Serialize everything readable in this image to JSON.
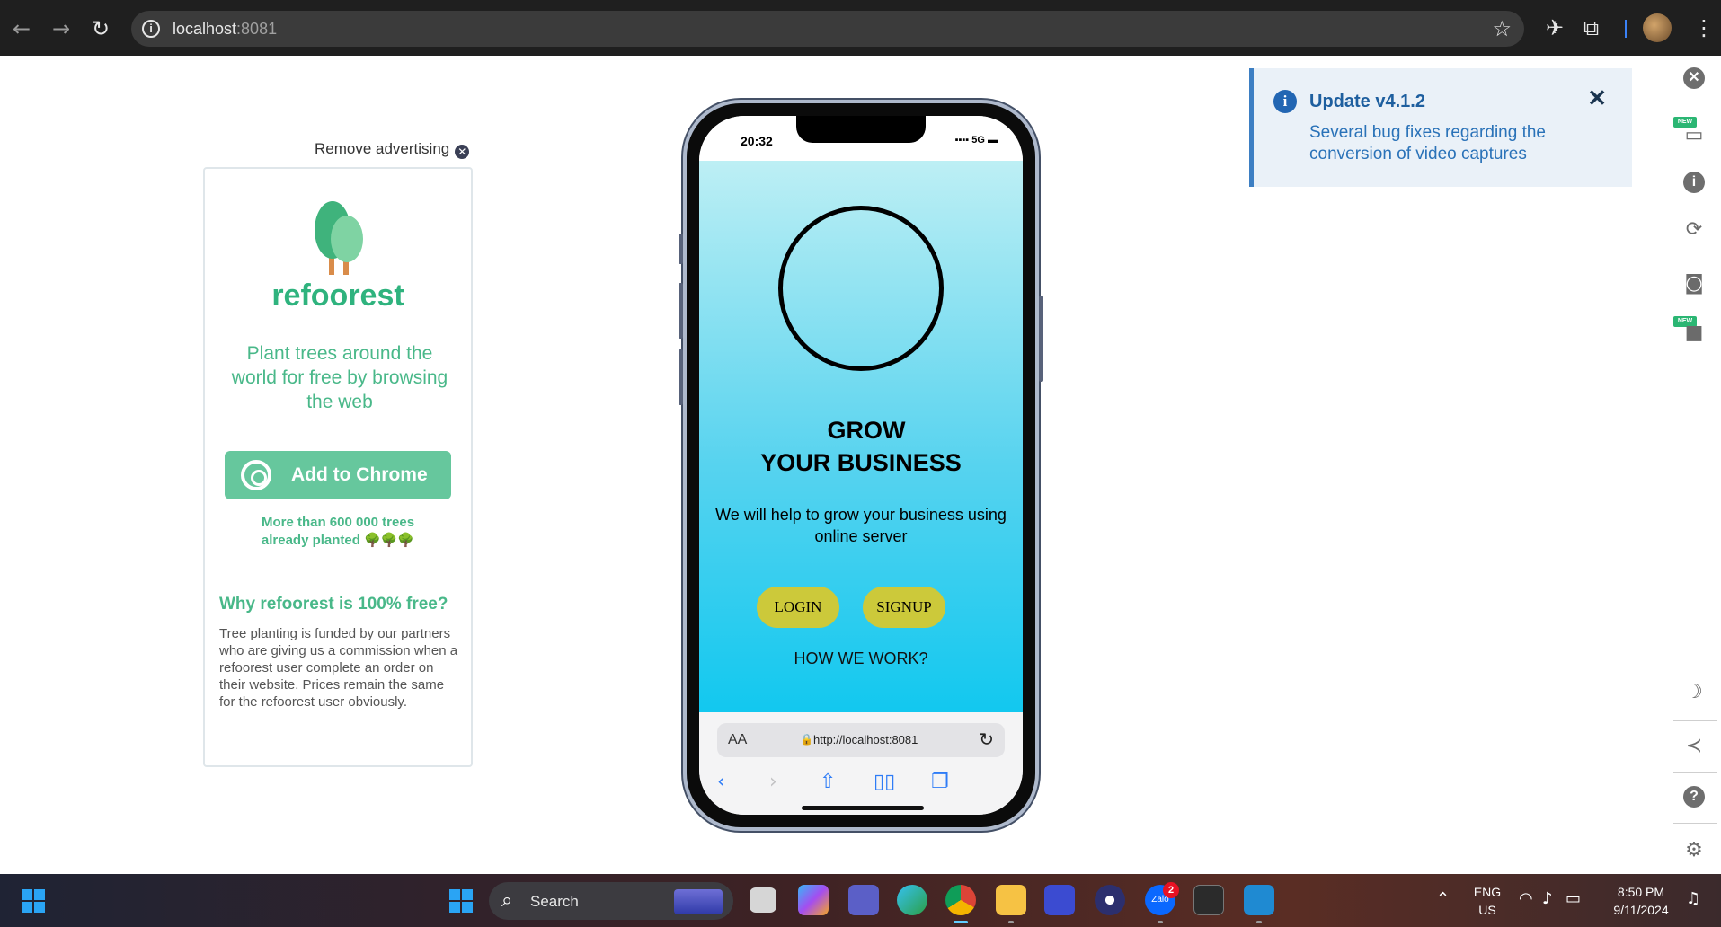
{
  "browser": {
    "url_host": "localhost",
    "url_port": ":8081",
    "nav_back": "←",
    "nav_forward": "→",
    "nav_reload": "↻",
    "star": "☆"
  },
  "ad": {
    "remove_label": "Remove advertising",
    "brand": "refoorest",
    "slogan": "Plant trees around the world for free by browsing the web",
    "button_label": "Add to Chrome",
    "trees_line1": "More than 600 000 trees",
    "trees_line2": "already planted 🌳🌳🌳",
    "why_title": "Why refoorest is 100% free?",
    "why_text": "Tree planting is funded by our partners who are giving us a commission when a refoorest user complete an order on their website. Prices remain the same for the refoorest user obviously.",
    "colors": {
      "brand": "#2fb37e",
      "button": "#66c79d"
    }
  },
  "phone": {
    "time": "20:32",
    "signal": "▪▪▪▪ 5G ▬",
    "headline_line1": "GROW",
    "headline_line2": "YOUR BUSINESS",
    "subtext": "We will help to grow your business using online server",
    "login_label": "LOGIN",
    "signup_label": "SIGNUP",
    "how_label": "HOW WE WORK?",
    "safari": {
      "aa": "AA",
      "url": "http://localhost:8081"
    },
    "colors": {
      "button": "#ccc93a",
      "gradient_top": "#bdeff4",
      "gradient_bottom": "#12c8ef"
    }
  },
  "toast": {
    "title": "Update v4.1.2",
    "message": "Several bug fixes regarding the conversion of video captures",
    "close": "✕",
    "colors": {
      "accent": "#3d7fc3",
      "background": "#eaf1f8"
    }
  },
  "right_toolbar": {
    "new_tag": "NEW"
  },
  "taskbar": {
    "search_label": "Search",
    "zalo_badge": "2",
    "zalo_text": "Zalo",
    "lang_line1": "ENG",
    "lang_line2": "US",
    "time": "8:50 PM",
    "date": "9/11/2024"
  }
}
